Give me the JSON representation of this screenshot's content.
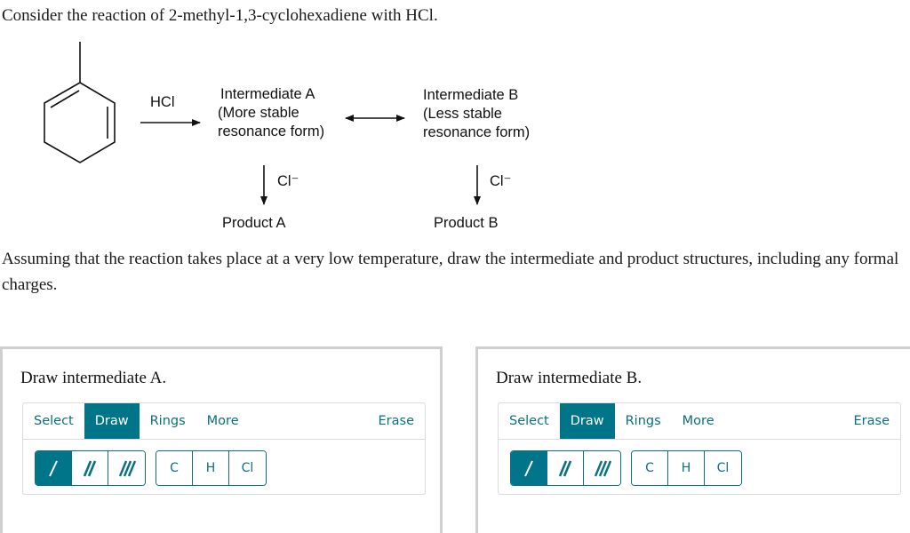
{
  "question": {
    "intro": "Consider the reaction of 2-methyl-1,3-cyclohexadiene with HCl.",
    "instruction": "Assuming that the reaction takes place at a very low temperature, draw the intermediate and product structures, including any formal charges."
  },
  "scheme": {
    "reagent": "HCl",
    "intermediate_a": [
      "Intermediate A",
      "(More stable",
      "resonance form)"
    ],
    "intermediate_b": [
      "Intermediate B",
      "(Less stable",
      "resonance form)"
    ],
    "nucleophile_a": "Cl⁻",
    "nucleophile_b": "Cl⁻",
    "product_a": "Product A",
    "product_b": "Product B",
    "starting_material_icon": "2-methyl-1,3-cyclohexadiene-structure",
    "resonance_arrow_icon": "double-headed-arrow"
  },
  "panels": [
    {
      "title": "Draw intermediate A.",
      "tabs": [
        "Select",
        "Draw",
        "Rings",
        "More"
      ],
      "active_tab": "Draw",
      "erase_label": "Erase",
      "bond_tools": [
        "single-bond",
        "double-bond",
        "triple-bond"
      ],
      "active_bond": "single-bond",
      "atom_tools": [
        "C",
        "H",
        "Cl"
      ]
    },
    {
      "title": "Draw intermediate B.",
      "tabs": [
        "Select",
        "Draw",
        "Rings",
        "More"
      ],
      "active_tab": "Draw",
      "erase_label": "Erase",
      "bond_tools": [
        "single-bond",
        "double-bond",
        "triple-bond"
      ],
      "active_bond": "single-bond",
      "atom_tools": [
        "C",
        "H",
        "Cl"
      ]
    }
  ],
  "colors": {
    "accent": "#00758a",
    "panel_border": "#cfcfcf",
    "toolbar_border": "#dcdcdc"
  }
}
